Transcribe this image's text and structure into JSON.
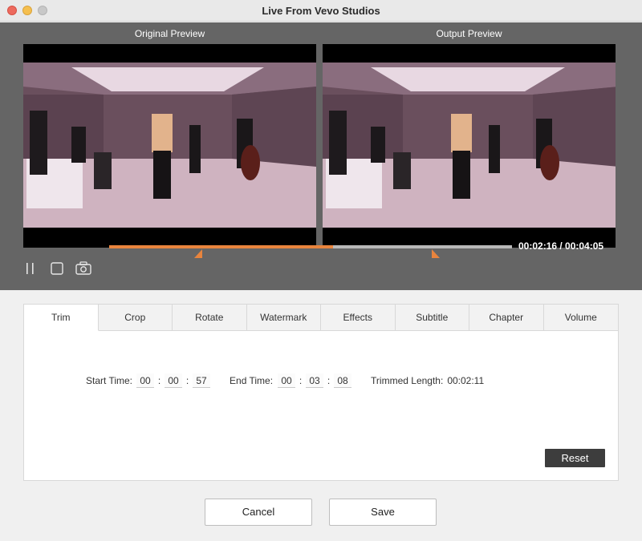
{
  "window": {
    "title": "Live From Vevo Studios"
  },
  "preview": {
    "original_label": "Original Preview",
    "output_label": "Output  Preview",
    "time_readout": "00:02:16 / 00:04:05",
    "playback_progress": 0.555,
    "trim_start_fraction": 0.232,
    "trim_end_fraction": 0.8,
    "accent_color": "#e8843d"
  },
  "tabs": [
    {
      "label": "Trim",
      "active": true
    },
    {
      "label": "Crop"
    },
    {
      "label": "Rotate"
    },
    {
      "label": "Watermark"
    },
    {
      "label": "Effects"
    },
    {
      "label": "Subtitle"
    },
    {
      "label": "Chapter"
    },
    {
      "label": "Volume"
    }
  ],
  "trim": {
    "start_label": "Start Time:",
    "start": {
      "h": "00",
      "m": "00",
      "s": "57"
    },
    "end_label": "End Time:",
    "end": {
      "h": "00",
      "m": "03",
      "s": "08"
    },
    "length_label": "Trimmed Length:",
    "length_value": "00:02:11",
    "reset_label": "Reset"
  },
  "footer": {
    "cancel_label": "Cancel",
    "save_label": "Save"
  },
  "icons": [
    "pause-icon",
    "stop-icon",
    "camera-icon"
  ]
}
